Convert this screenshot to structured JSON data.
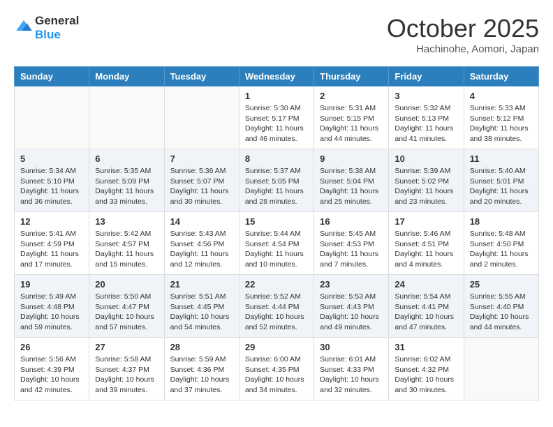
{
  "header": {
    "logo_line1": "General",
    "logo_line2": "Blue",
    "month": "October 2025",
    "location": "Hachinohe, Aomori, Japan"
  },
  "weekdays": [
    "Sunday",
    "Monday",
    "Tuesday",
    "Wednesday",
    "Thursday",
    "Friday",
    "Saturday"
  ],
  "weeks": [
    [
      {
        "day": "",
        "info": ""
      },
      {
        "day": "",
        "info": ""
      },
      {
        "day": "",
        "info": ""
      },
      {
        "day": "1",
        "info": "Sunrise: 5:30 AM\nSunset: 5:17 PM\nDaylight: 11 hours and 46 minutes."
      },
      {
        "day": "2",
        "info": "Sunrise: 5:31 AM\nSunset: 5:15 PM\nDaylight: 11 hours and 44 minutes."
      },
      {
        "day": "3",
        "info": "Sunrise: 5:32 AM\nSunset: 5:13 PM\nDaylight: 11 hours and 41 minutes."
      },
      {
        "day": "4",
        "info": "Sunrise: 5:33 AM\nSunset: 5:12 PM\nDaylight: 11 hours and 38 minutes."
      }
    ],
    [
      {
        "day": "5",
        "info": "Sunrise: 5:34 AM\nSunset: 5:10 PM\nDaylight: 11 hours and 36 minutes."
      },
      {
        "day": "6",
        "info": "Sunrise: 5:35 AM\nSunset: 5:09 PM\nDaylight: 11 hours and 33 minutes."
      },
      {
        "day": "7",
        "info": "Sunrise: 5:36 AM\nSunset: 5:07 PM\nDaylight: 11 hours and 30 minutes."
      },
      {
        "day": "8",
        "info": "Sunrise: 5:37 AM\nSunset: 5:05 PM\nDaylight: 11 hours and 28 minutes."
      },
      {
        "day": "9",
        "info": "Sunrise: 5:38 AM\nSunset: 5:04 PM\nDaylight: 11 hours and 25 minutes."
      },
      {
        "day": "10",
        "info": "Sunrise: 5:39 AM\nSunset: 5:02 PM\nDaylight: 11 hours and 23 minutes."
      },
      {
        "day": "11",
        "info": "Sunrise: 5:40 AM\nSunset: 5:01 PM\nDaylight: 11 hours and 20 minutes."
      }
    ],
    [
      {
        "day": "12",
        "info": "Sunrise: 5:41 AM\nSunset: 4:59 PM\nDaylight: 11 hours and 17 minutes."
      },
      {
        "day": "13",
        "info": "Sunrise: 5:42 AM\nSunset: 4:57 PM\nDaylight: 11 hours and 15 minutes."
      },
      {
        "day": "14",
        "info": "Sunrise: 5:43 AM\nSunset: 4:56 PM\nDaylight: 11 hours and 12 minutes."
      },
      {
        "day": "15",
        "info": "Sunrise: 5:44 AM\nSunset: 4:54 PM\nDaylight: 11 hours and 10 minutes."
      },
      {
        "day": "16",
        "info": "Sunrise: 5:45 AM\nSunset: 4:53 PM\nDaylight: 11 hours and 7 minutes."
      },
      {
        "day": "17",
        "info": "Sunrise: 5:46 AM\nSunset: 4:51 PM\nDaylight: 11 hours and 4 minutes."
      },
      {
        "day": "18",
        "info": "Sunrise: 5:48 AM\nSunset: 4:50 PM\nDaylight: 11 hours and 2 minutes."
      }
    ],
    [
      {
        "day": "19",
        "info": "Sunrise: 5:49 AM\nSunset: 4:48 PM\nDaylight: 10 hours and 59 minutes."
      },
      {
        "day": "20",
        "info": "Sunrise: 5:50 AM\nSunset: 4:47 PM\nDaylight: 10 hours and 57 minutes."
      },
      {
        "day": "21",
        "info": "Sunrise: 5:51 AM\nSunset: 4:45 PM\nDaylight: 10 hours and 54 minutes."
      },
      {
        "day": "22",
        "info": "Sunrise: 5:52 AM\nSunset: 4:44 PM\nDaylight: 10 hours and 52 minutes."
      },
      {
        "day": "23",
        "info": "Sunrise: 5:53 AM\nSunset: 4:43 PM\nDaylight: 10 hours and 49 minutes."
      },
      {
        "day": "24",
        "info": "Sunrise: 5:54 AM\nSunset: 4:41 PM\nDaylight: 10 hours and 47 minutes."
      },
      {
        "day": "25",
        "info": "Sunrise: 5:55 AM\nSunset: 4:40 PM\nDaylight: 10 hours and 44 minutes."
      }
    ],
    [
      {
        "day": "26",
        "info": "Sunrise: 5:56 AM\nSunset: 4:39 PM\nDaylight: 10 hours and 42 minutes."
      },
      {
        "day": "27",
        "info": "Sunrise: 5:58 AM\nSunset: 4:37 PM\nDaylight: 10 hours and 39 minutes."
      },
      {
        "day": "28",
        "info": "Sunrise: 5:59 AM\nSunset: 4:36 PM\nDaylight: 10 hours and 37 minutes."
      },
      {
        "day": "29",
        "info": "Sunrise: 6:00 AM\nSunset: 4:35 PM\nDaylight: 10 hours and 34 minutes."
      },
      {
        "day": "30",
        "info": "Sunrise: 6:01 AM\nSunset: 4:33 PM\nDaylight: 10 hours and 32 minutes."
      },
      {
        "day": "31",
        "info": "Sunrise: 6:02 AM\nSunset: 4:32 PM\nDaylight: 10 hours and 30 minutes."
      },
      {
        "day": "",
        "info": ""
      }
    ]
  ]
}
